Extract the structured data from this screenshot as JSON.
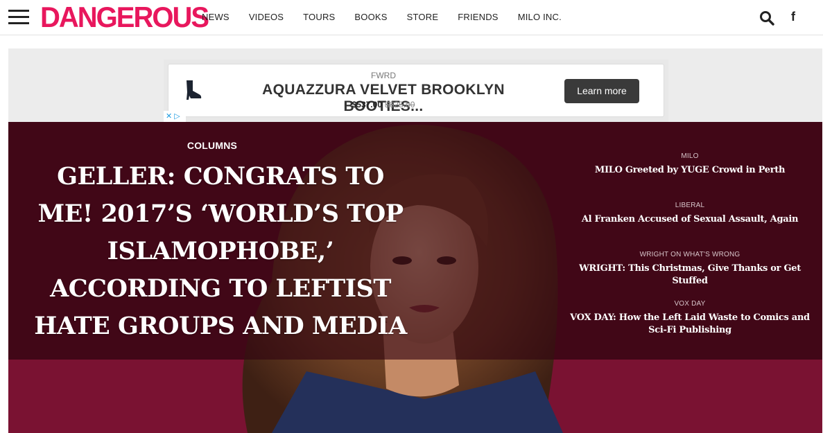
{
  "site": {
    "logo": "DANGEROUS"
  },
  "nav": {
    "items": [
      "NEWS",
      "VIDEOS",
      "TOURS",
      "BOOKS",
      "STORE",
      "FRIENDS",
      "MILO INC."
    ],
    "facebook_glyph": "f",
    "menu_icon": "hamburger-icon",
    "search_icon": "search-icon"
  },
  "ad": {
    "brand": "FWRD",
    "title": "AQUAZZURA VELVET BROOKLYN BOOTIES...",
    "price": "$537.00",
    "old_price": "$825.00",
    "cta": "Learn more",
    "adchoices_glyph": "✕ ▷"
  },
  "hero": {
    "category": "COLUMNS",
    "headline": "GELLER: CONGRATS TO ME! 2017’S ‘WORLD’S TOP ISLAMOPHOBE,’ ACCORDING TO LEFTIST HATE GROUPS AND MEDIA"
  },
  "side_stories": [
    {
      "category": "MILO",
      "title": "MILO Greeted by YUGE Crowd in Perth"
    },
    {
      "category": "LIBERAL",
      "title": "Al Franken Accused of Sexual Assault, Again"
    },
    {
      "category": "WRIGHT ON WHAT'S WRONG",
      "title": "WRIGHT: This Christmas, Give Thanks or Get Stuffed"
    },
    {
      "category": "VOX DAY",
      "title": "VOX DAY: How the Left Laid Waste to Comics and Sci-Fi Publishing"
    }
  ],
  "colors": {
    "brand": "#e8175d",
    "hero_dark": "#5d0f22",
    "hero_light": "#7a1232"
  }
}
